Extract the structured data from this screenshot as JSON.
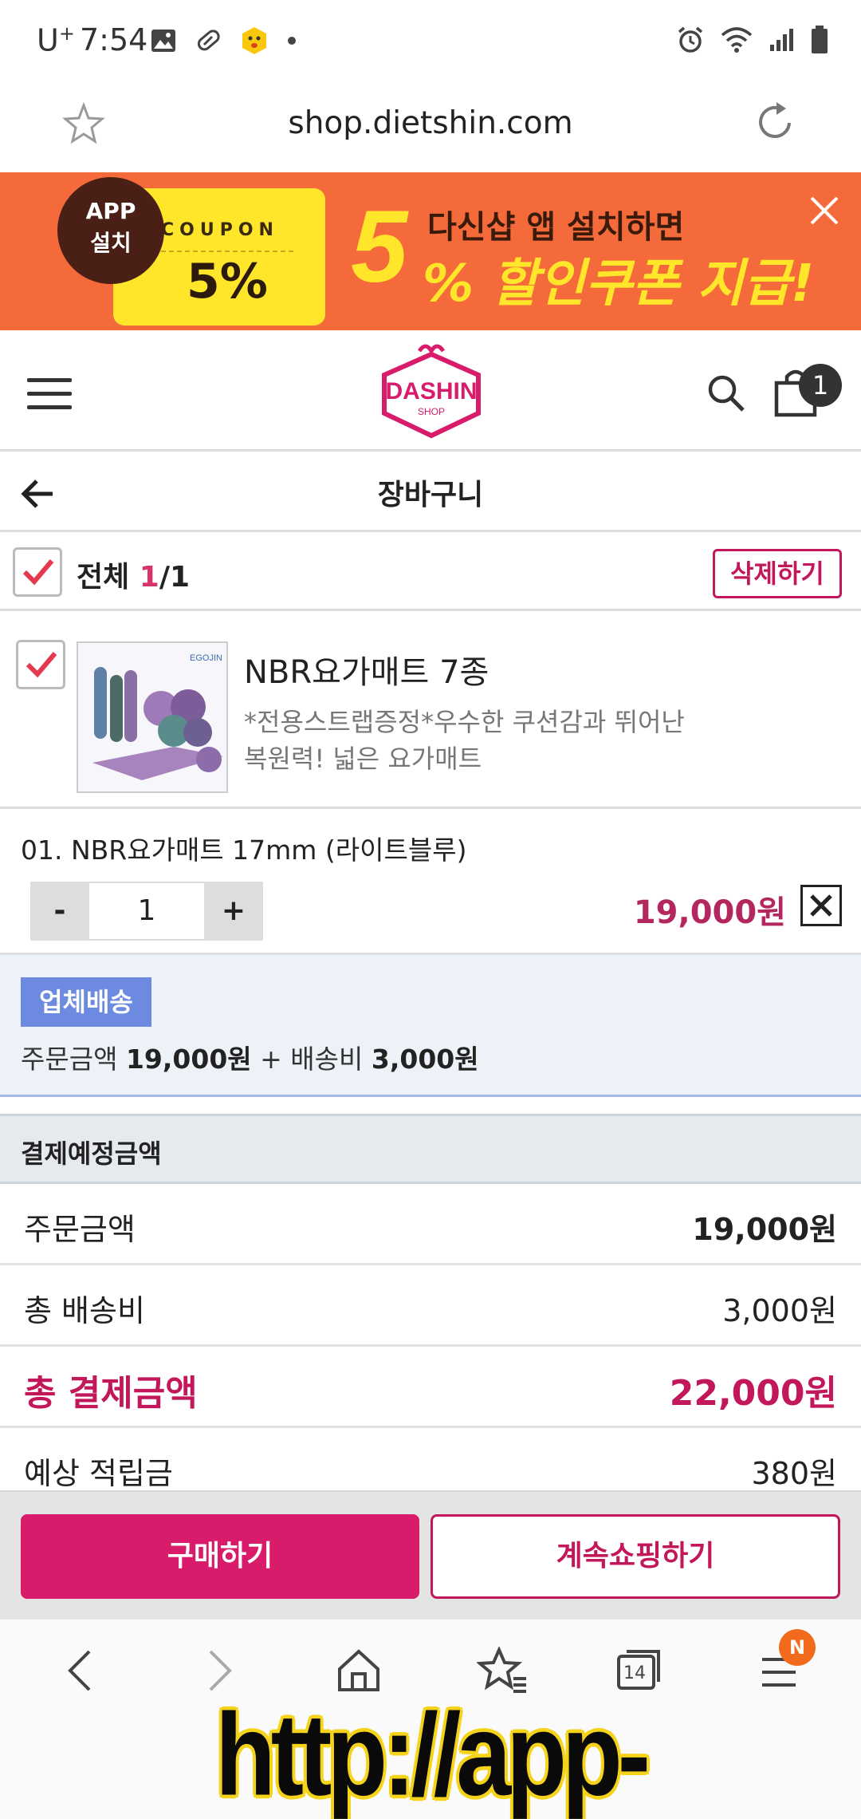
{
  "status_bar": {
    "carrier": "U",
    "carrier_sup": "+",
    "time": "7:54"
  },
  "url_bar": {
    "url": "shop.dietshin.com"
  },
  "banner": {
    "app_line1": "APP",
    "app_line2": "설치",
    "coupon_word": "COUPON",
    "coupon_value": "5%",
    "big_five": "5",
    "headline1": "다신샵 앱 설치하면",
    "headline2": "% 할인쿠폰 지급!"
  },
  "header": {
    "logo_main": "DASHIN",
    "logo_sub": "SHOP",
    "cart_count": "1"
  },
  "page": {
    "title": "장바구니"
  },
  "select_bar": {
    "all_label": "전체",
    "selected": "1",
    "total": "/1",
    "delete_label": "삭제하기"
  },
  "product": {
    "name": "NBR요가매트 7종",
    "desc_line1": "*전용스트랩증정*우수한 쿠션감과 뛰어난",
    "desc_line2": "복원력! 넓은 요가매트",
    "thumb_brand": "EGOJIN"
  },
  "option": {
    "name": "01. NBR요가매트 17mm (라이트블루)",
    "minus": "-",
    "quantity": "1",
    "plus": "+",
    "price": "19,000원"
  },
  "shipping": {
    "badge": "업체배송",
    "prefix": "주문금액 ",
    "order_amount": "19,000원",
    "mid": " + 배송비 ",
    "fee": "3,000원"
  },
  "summary": {
    "heading": "결제예정금액",
    "rows": [
      {
        "label": "주문금액",
        "value": "19,000원"
      },
      {
        "label": "총 배송비",
        "value": "3,000원"
      },
      {
        "label": "총 결제금액",
        "value": "22,000원"
      },
      {
        "label": "예상 적립금",
        "value": "380원"
      }
    ]
  },
  "actions": {
    "buy": "구매하기",
    "continue": "계속쇼핑하기"
  },
  "browser_nav": {
    "tabs_count": "14",
    "menu_badge": "N"
  },
  "watermark": "http://app-tech.tistory.com",
  "colors": {
    "accent": "#d81b6a",
    "banner_bg": "#f46a3b",
    "banner_yellow": "#ffe62b",
    "shipping_badge": "#6b8ae0"
  }
}
